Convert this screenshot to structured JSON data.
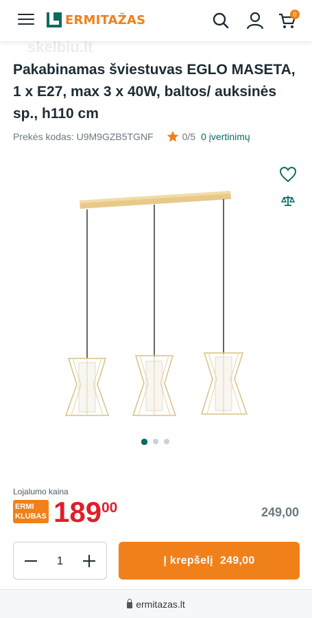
{
  "header": {
    "logo_text": "ERMITAŽAS",
    "cart_count": "0",
    "brand_color": "#f0801a",
    "accent_color": "#0b6b63"
  },
  "watermark": "skelbiu.lt",
  "product": {
    "title": "Pakabinamas šviestuvas EGLO MASETA, 1 x E27, max 3 x 40W, baltos/ auksinės sp., h110 cm",
    "code_label": "Prekės kodas: U9M9GZB5TGNF",
    "rating": "0/5",
    "reviews": "0 įvertinimų"
  },
  "gallery": {
    "dots": 3,
    "active_index": 0
  },
  "pricing": {
    "loyalty_label": "Lojalumo kaina",
    "badge_line1": "ERMI",
    "badge_line2": "KLUBAS",
    "price_main": "189",
    "price_cents": "00",
    "price_old": "249,00"
  },
  "cart": {
    "quantity": "1",
    "add_label": "Į krepšelį",
    "add_price": "249,00"
  },
  "browser": {
    "url": "ermitazas.lt"
  }
}
